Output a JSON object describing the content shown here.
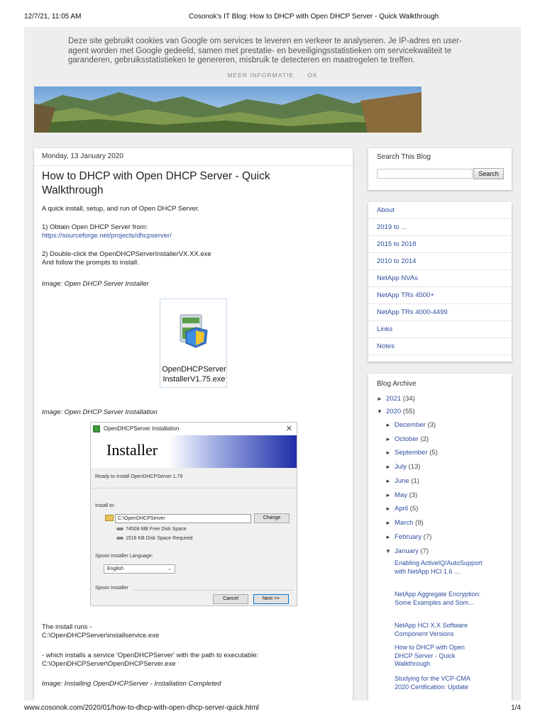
{
  "print": {
    "timestamp": "12/7/21, 11:05 AM",
    "title": "Cosonok's IT Blog: How to DHCP with Open DHCP Server - Quick Walkthrough",
    "url": "www.cosonok.com/2020/01/how-to-dhcp-with-open-dhcp-server-quick.html",
    "page": "1/4"
  },
  "cookie": {
    "text": "Deze site gebruikt cookies van Google om services te leveren en verkeer te analyseren. Je IP-adres en user-agent worden met Google gedeeld, samen met prestatie- en beveiligingsstatistieken om servicekwaliteit te garanderen, gebruiksstatistieken te genereren, misbruik te detecteren en maatregelen te treffen.",
    "more_info": "MEER INFORMATIE",
    "ok": "OK"
  },
  "post": {
    "date": "Monday, 13 January 2020",
    "title": "How to DHCP with Open DHCP Server - Quick Walkthrough",
    "intro": "A quick install, setup, and run of Open DHCP Server.",
    "step1": "1) Obtain Open DHCP Server from:",
    "step1_link": "https://sourceforge.net/projects/dhcpserver/",
    "step2_line1": "2) Double-click the OpenDHCPServerInstallerVX.XX.exe",
    "step2_line2": "And follow the prompts to install.",
    "caption_installer": "Image: Open DHCP Server Installer",
    "file_icon_line1": "OpenDHCPServer",
    "file_icon_line2": "InstallerV1.75.exe",
    "caption_installation": "Image: Open DHCP Server Installation",
    "install_runs": "The install runs -",
    "install_runs_path": "C:\\OpenDHCPServer\\installservice.exe",
    "service_line": "- which installs a service 'OpenDHCPServer' with the path to executable:",
    "service_path": "C:\\OpenDHCPServer\\OpenDHCPServer.exe",
    "caption_completed": "Image: Installing OpenDHCPServer - Installation Completed"
  },
  "installer_window": {
    "title": "OpenDHCPServer Installation",
    "close": "✕",
    "banner": "Installer",
    "ready": "Ready to Install OpenDHCPServer 1.75",
    "install_to_label": "Install to:",
    "path": "C:\\OpenDHCPServer",
    "change": "Change",
    "free_space": "74508 MB Free Disk Space",
    "required_space": "1518 KB Disk Space Required",
    "language_label": "Spoon Installer Language:",
    "language": "English",
    "brand": "Spoon Installer",
    "cancel": "Cancel",
    "next": "Next >>"
  },
  "search": {
    "title": "Search This Blog",
    "button": "Search"
  },
  "pages": [
    "About",
    "2019 to ...",
    "2015 to 2018",
    "2010 to 2014",
    "NetApp NVAs",
    "NetApp TRs 4500+",
    "NetApp TRs 4000-4499",
    "Links",
    "Notes"
  ],
  "archive": {
    "title": "Blog Archive",
    "years": [
      {
        "label": "2021",
        "count": "(34)",
        "arrow": "►"
      },
      {
        "label": "2020",
        "count": "(55)",
        "arrow": "▼"
      }
    ],
    "months": [
      {
        "label": "December",
        "count": "(3)",
        "arrow": "►"
      },
      {
        "label": "October",
        "count": "(2)",
        "arrow": "►"
      },
      {
        "label": "September",
        "count": "(5)",
        "arrow": "►"
      },
      {
        "label": "July",
        "count": "(13)",
        "arrow": "►"
      },
      {
        "label": "June",
        "count": "(1)",
        "arrow": "►"
      },
      {
        "label": "May",
        "count": "(3)",
        "arrow": "►"
      },
      {
        "label": "April",
        "count": "(5)",
        "arrow": "►"
      },
      {
        "label": "March",
        "count": "(9)",
        "arrow": "►"
      },
      {
        "label": "February",
        "count": "(7)",
        "arrow": "►"
      },
      {
        "label": "January",
        "count": "(7)",
        "arrow": "▼"
      }
    ],
    "posts": [
      "Enabling ActiveIQ/AutoSupport with NetApp HCI 1.6 ...",
      "NetApp Aggregate Encryption: Some Examples and Som...",
      "NetApp HCI X.X Software Component Versions",
      "How to DHCP with Open DHCP Server - Quick Walkthrough",
      "Studying for the VCP-CMA 2020 Certification: Update"
    ]
  },
  "colors": {
    "link": "#2e4da0",
    "page_background": "#eeeeee",
    "installer_banner": "#1f2ea8"
  }
}
